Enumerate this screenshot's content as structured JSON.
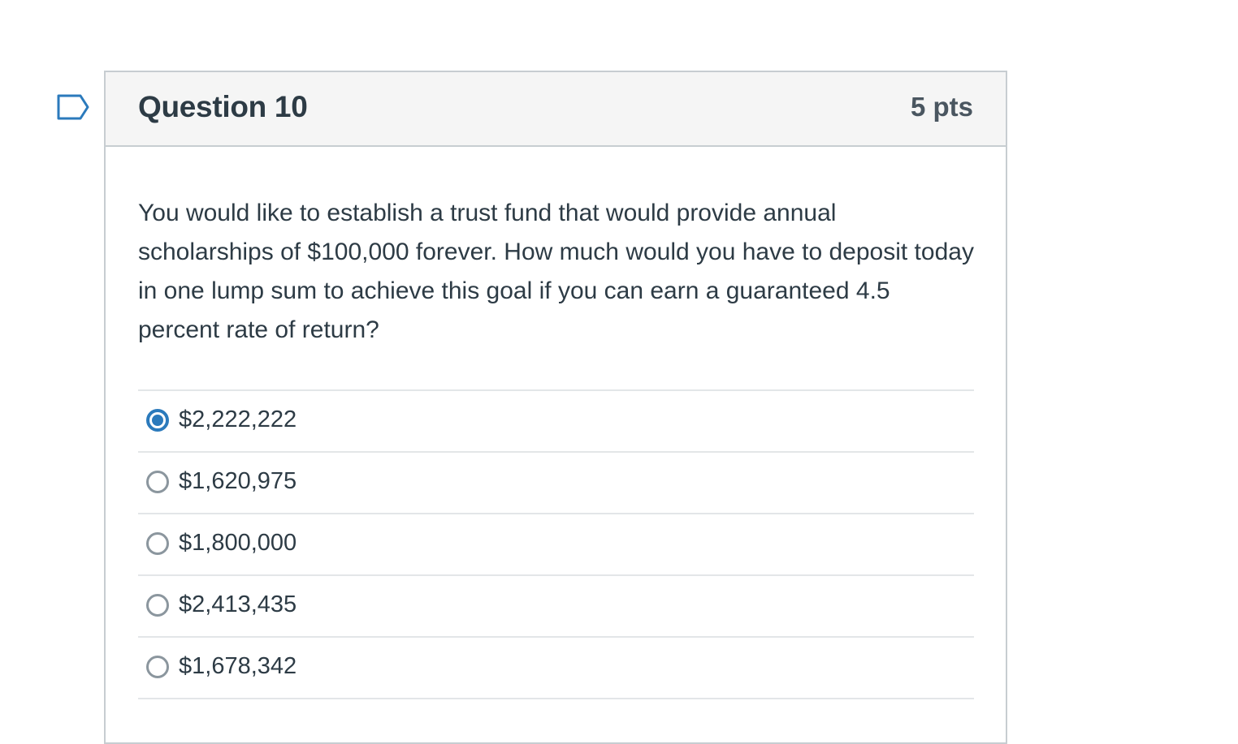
{
  "question": {
    "title": "Question 10",
    "points": "5 pts",
    "text": "You would like to establish a trust fund that would provide annual scholarships of $100,000 forever. How much would you have to deposit today in one lump sum to achieve this goal if you can earn a guaranteed 4.5 percent rate of return?",
    "flag_icon": "bookmark-flag-icon"
  },
  "answers": [
    {
      "label": "$2,222,222",
      "selected": true
    },
    {
      "label": "$1,620,975",
      "selected": false
    },
    {
      "label": "$1,800,000",
      "selected": false
    },
    {
      "label": "$2,413,435",
      "selected": false
    },
    {
      "label": "$1,678,342",
      "selected": false
    }
  ],
  "colors": {
    "accent": "#2b7abc",
    "text": "#2d3b45",
    "header_bg": "#f5f5f5",
    "border": "#c7cdd1"
  }
}
